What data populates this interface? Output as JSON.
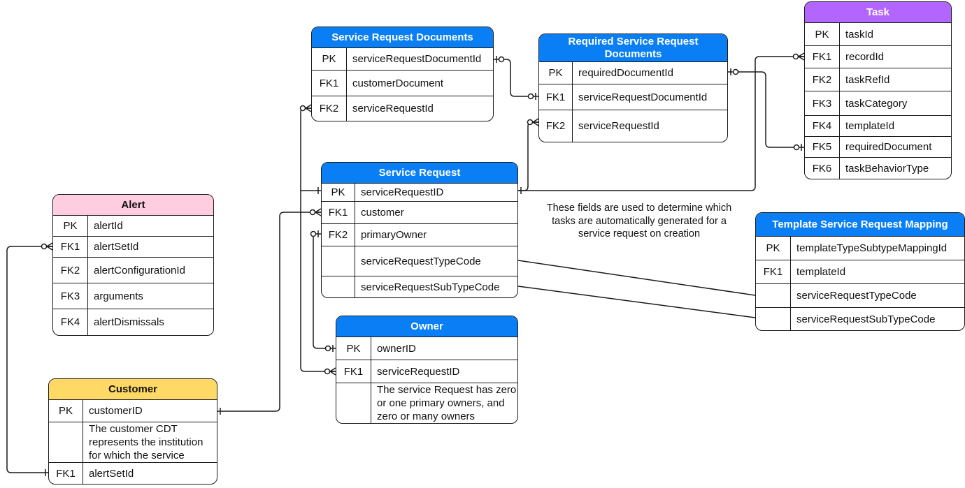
{
  "tables": [
    {
      "title": "Service Request Documents",
      "header_color": "#0a7ff5",
      "title_color": "#ffffff",
      "rows": [
        {
          "key": "PK",
          "field": "serviceRequestDocumentId"
        },
        {
          "key": "FK1",
          "field": "customerDocument"
        },
        {
          "key": "FK2",
          "field": "serviceRequestId"
        }
      ]
    },
    {
      "title": "Required Service Request Documents",
      "header_color": "#0a7ff5",
      "title_color": "#ffffff",
      "rows": [
        {
          "key": "PK",
          "field": "requiredDocumentId"
        },
        {
          "key": "FK1",
          "field": "serviceRequestDocumentId"
        },
        {
          "key": "FK2",
          "field": "serviceRequestId"
        }
      ]
    },
    {
      "title": "Task",
      "header_color": "#b366ff",
      "title_color": "#ffffff",
      "rows": [
        {
          "key": "PK",
          "field": "taskId"
        },
        {
          "key": "FK1",
          "field": "recordId"
        },
        {
          "key": "FK2",
          "field": "taskRefId"
        },
        {
          "key": "FK3",
          "field": "taskCategory"
        },
        {
          "key": "FK4",
          "field": "templateId"
        },
        {
          "key": "FK5",
          "field": "requiredDocument"
        },
        {
          "key": "FK6",
          "field": "taskBehaviorType"
        }
      ]
    },
    {
      "title": "Service Request",
      "header_color": "#0a7ff5",
      "title_color": "#ffffff",
      "rows": [
        {
          "key": "PK",
          "field": "serviceRequestID"
        },
        {
          "key": "FK1",
          "field": "customer"
        },
        {
          "key": "FK2",
          "field": "primaryOwner"
        },
        {
          "key": "",
          "field": "serviceRequestTypeCode"
        },
        {
          "key": "",
          "field": "serviceRequestSubTypeCode"
        }
      ]
    },
    {
      "title": "Alert",
      "header_color": "#ffcce0",
      "title_color": "#111111",
      "rows": [
        {
          "key": "PK",
          "field": "alertId"
        },
        {
          "key": "FK1",
          "field": "alertSetId"
        },
        {
          "key": "FK2",
          "field": "alertConfigurationId"
        },
        {
          "key": "FK3",
          "field": "arguments"
        },
        {
          "key": "FK4",
          "field": "alertDismissals"
        }
      ]
    },
    {
      "title": "Customer",
      "header_color": "#ffd966",
      "title_color": "#111111",
      "rows": [
        {
          "key": "PK",
          "field": "customerID"
        },
        {
          "key": "",
          "field": "The customer CDT represents the institution for which the service"
        },
        {
          "key": "FK1",
          "field": "alertSetId"
        }
      ]
    },
    {
      "title": "Owner",
      "header_color": "#0a7ff5",
      "title_color": "#ffffff",
      "rows": [
        {
          "key": "PK",
          "field": "ownerID"
        },
        {
          "key": "FK1",
          "field": "serviceRequestID"
        },
        {
          "key": "",
          "field": "The service Request has zero or one primary owners, and zero or many owners"
        }
      ]
    },
    {
      "title": "Template Service Request Mapping",
      "header_color": "#0a7ff5",
      "title_color": "#ffffff",
      "rows": [
        {
          "key": "PK",
          "field": "templateTypeSubtypeMappingId"
        },
        {
          "key": "FK1",
          "field": "templateId"
        },
        {
          "key": "",
          "field": "serviceRequestTypeCode"
        },
        {
          "key": "",
          "field": "serviceRequestSubTypeCode"
        }
      ]
    }
  ],
  "note": "These fields are used to determine which tasks are automatically generated for a service request on creation",
  "line_color": "#1a1a1a"
}
